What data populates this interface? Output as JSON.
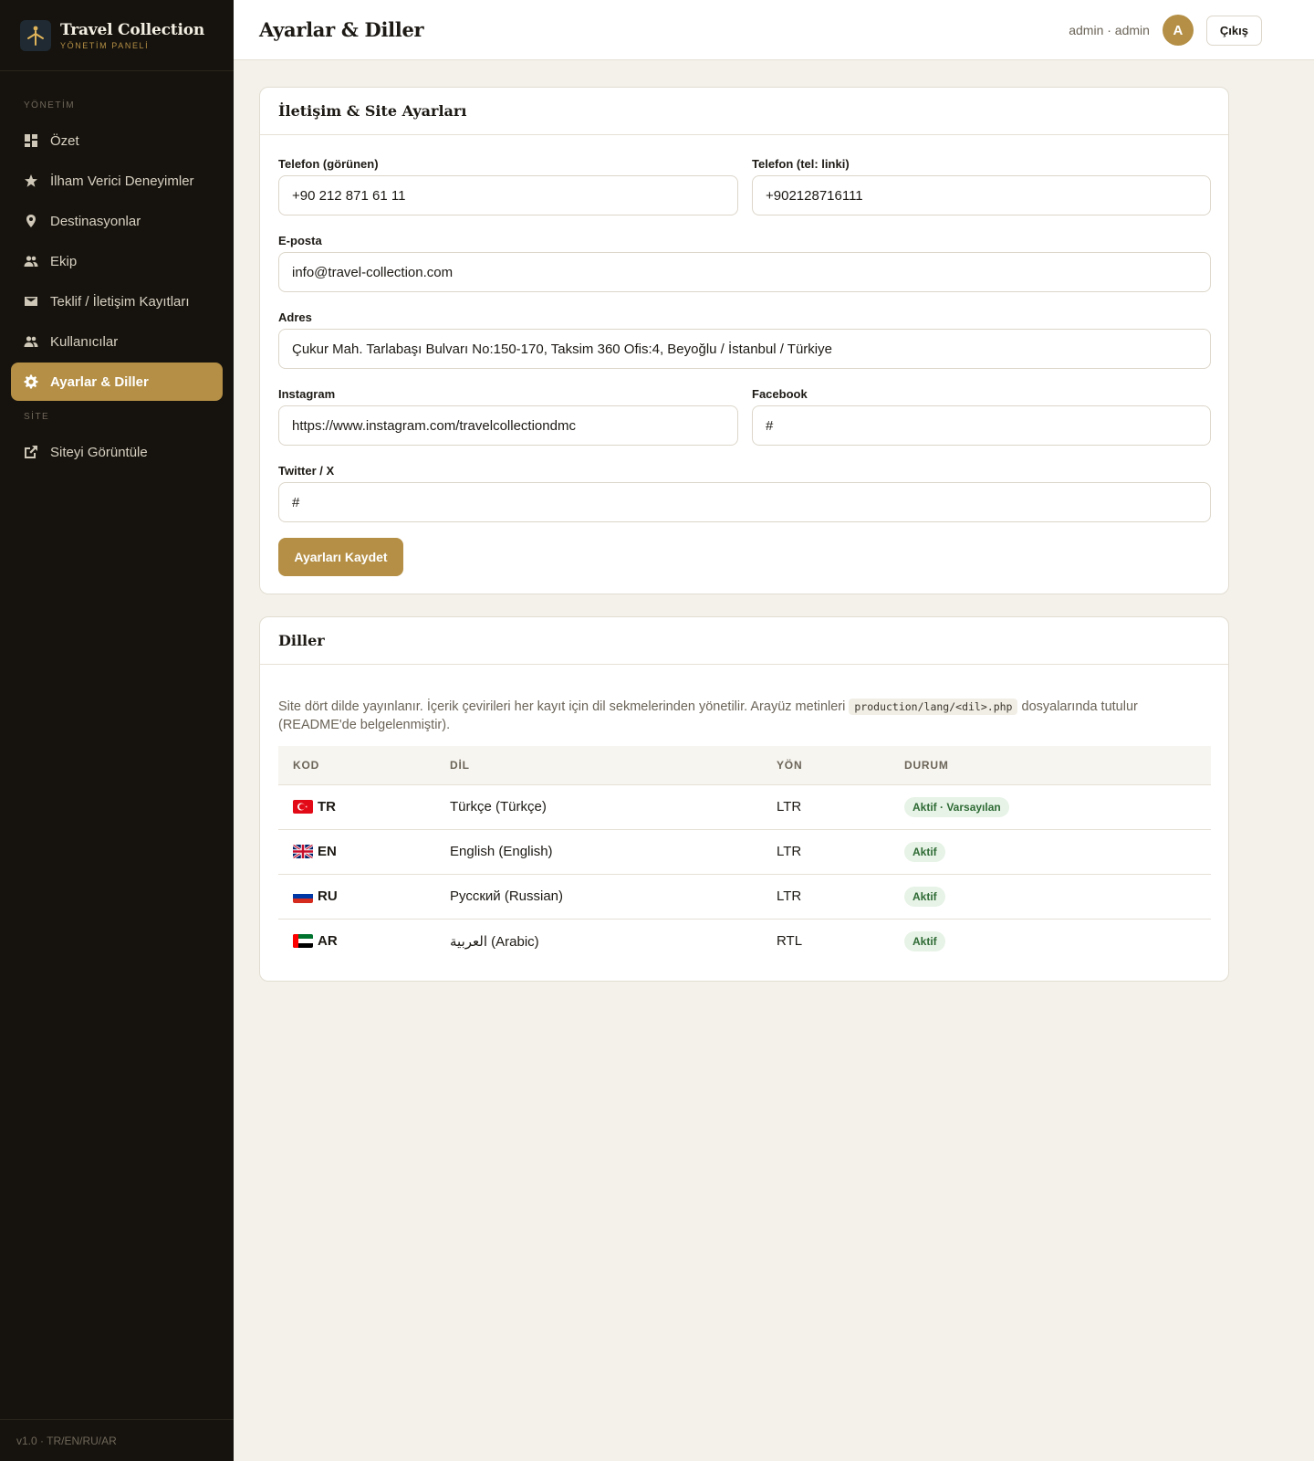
{
  "brand": {
    "title": "Travel Collection",
    "subtitle": "YÖNETİM PANELİ"
  },
  "sidebar": {
    "section_admin": "YÖNETİM",
    "section_site": "SİTE",
    "items": [
      {
        "label": "Özet",
        "icon": "dashboard-icon"
      },
      {
        "label": "İlham Verici Deneyimler",
        "icon": "star-icon"
      },
      {
        "label": "Destinasyonlar",
        "icon": "map-pin-icon"
      },
      {
        "label": "Ekip",
        "icon": "people-icon"
      },
      {
        "label": "Teklif / İletişim Kayıtları",
        "icon": "mail-icon"
      },
      {
        "label": "Kullanıcılar",
        "icon": "people-icon"
      },
      {
        "label": "Ayarlar & Diller",
        "icon": "gear-icon",
        "active": true
      }
    ],
    "site_items": [
      {
        "label": "Siteyi Görüntüle",
        "icon": "external-link-icon"
      }
    ],
    "footer": "v1.0 · TR/EN/RU/AR"
  },
  "header": {
    "title": "Ayarlar & Diller",
    "user": "admin · admin",
    "avatar_letter": "A",
    "logout": "Çıkış"
  },
  "settings": {
    "title": "İletişim & Site Ayarları",
    "phone_display_label": "Telefon (görünen)",
    "phone_display_value": "+90 212 871 61 11",
    "phone_link_label": "Telefon (tel: linki)",
    "phone_link_value": "+902128716111",
    "email_label": "E-posta",
    "email_value": "info@travel-collection.com",
    "address_label": "Adres",
    "address_value": "Çukur Mah. Tarlabaşı Bulvarı No:150-170, Taksim 360 Ofis:4, Beyoğlu / İstanbul / Türkiye",
    "instagram_label": "Instagram",
    "instagram_value": "https://www.instagram.com/travelcollectiondmc",
    "facebook_label": "Facebook",
    "facebook_value": "#",
    "twitter_label": "Twitter / X",
    "twitter_value": "#",
    "save_label": "Ayarları Kaydet"
  },
  "languages": {
    "title": "Diller",
    "desc_1": "Site dört dilde yayınlanır. İçerik çevirileri her kayıt için dil sekmelerinden yönetilir. Arayüz metinleri",
    "desc_code": "production/lang/<dil>.php",
    "desc_2": "dosyalarında tutulur (README'de belgelenmiştir).",
    "columns": [
      "KOD",
      "DİL",
      "YÖN",
      "DURUM"
    ],
    "rows": [
      {
        "code": "TR",
        "name": "Türkçe (Türkçe)",
        "dir": "LTR",
        "status": "Aktif · Varsayılan",
        "flag": "turkey-flag-icon"
      },
      {
        "code": "EN",
        "name": "English (English)",
        "dir": "LTR",
        "status": "Aktif",
        "flag": "uk-flag-icon"
      },
      {
        "code": "RU",
        "name": "Русский (Russian)",
        "dir": "LTR",
        "status": "Aktif",
        "flag": "russia-flag-icon"
      },
      {
        "code": "AR",
        "name": "العربية (Arabic)",
        "dir": "RTL",
        "status": "Aktif",
        "flag": "uae-flag-icon"
      }
    ]
  },
  "colors": {
    "accent": "#b48f45",
    "sidebar_bg": "#16130e",
    "page_bg": "#f3f1ea",
    "badge_bg": "#e7f3e7",
    "badge_text": "#2f6b35"
  }
}
